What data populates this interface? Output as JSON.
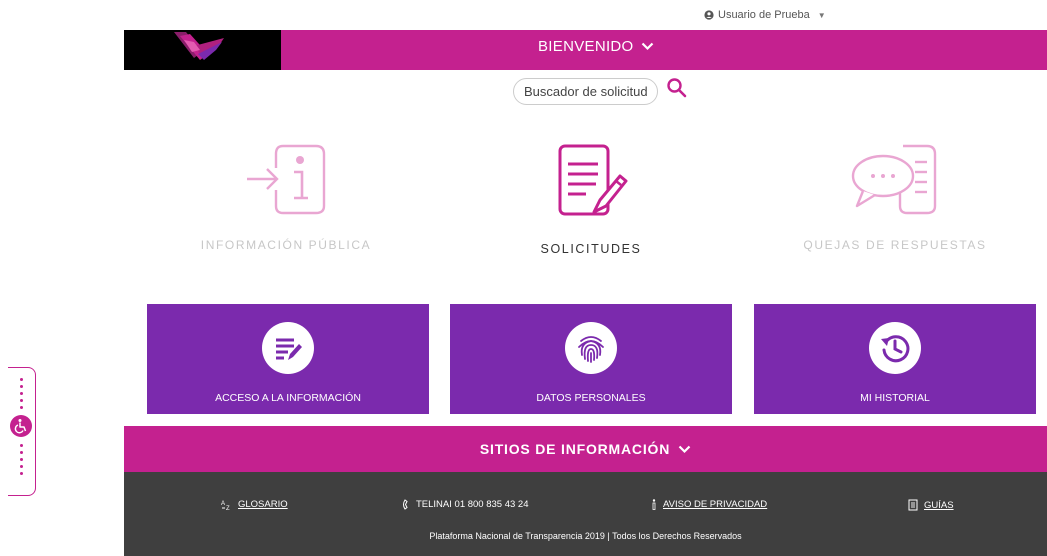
{
  "user_menu": {
    "label": "Usuario de Prueba"
  },
  "topbar": {
    "welcome": "BIENVENIDO"
  },
  "search": {
    "placeholder": "Buscador de solicitudes"
  },
  "features": [
    {
      "label": "INFORMACIÓN PÚBLICA",
      "state": "faded"
    },
    {
      "label": "SOLICITUDES",
      "state": "active"
    },
    {
      "label": "QUEJAS DE RESPUESTAS",
      "state": "faded"
    }
  ],
  "cards": [
    {
      "label": "ACCESO A LA INFORMACIÓN",
      "icon": "edit-document-icon"
    },
    {
      "label": "DATOS PERSONALES",
      "icon": "fingerprint-icon"
    },
    {
      "label": "MI HISTORIAL",
      "icon": "history-icon"
    }
  ],
  "sites": {
    "label": "SITIOS DE INFORMACIÓN"
  },
  "footer": {
    "glossary": "GLOSARIO",
    "phone": "TELINAI 01 800 835 43 24",
    "privacy": "AVISO DE PRIVACIDAD",
    "guides": "GUÍAS",
    "copyright": "Plataforma Nacional de Transparencia 2019 | Todos los Derechos Reservados"
  },
  "colors": {
    "magenta": "#c4218f",
    "purple": "#7b2aad",
    "footer": "#3f3f3f"
  }
}
